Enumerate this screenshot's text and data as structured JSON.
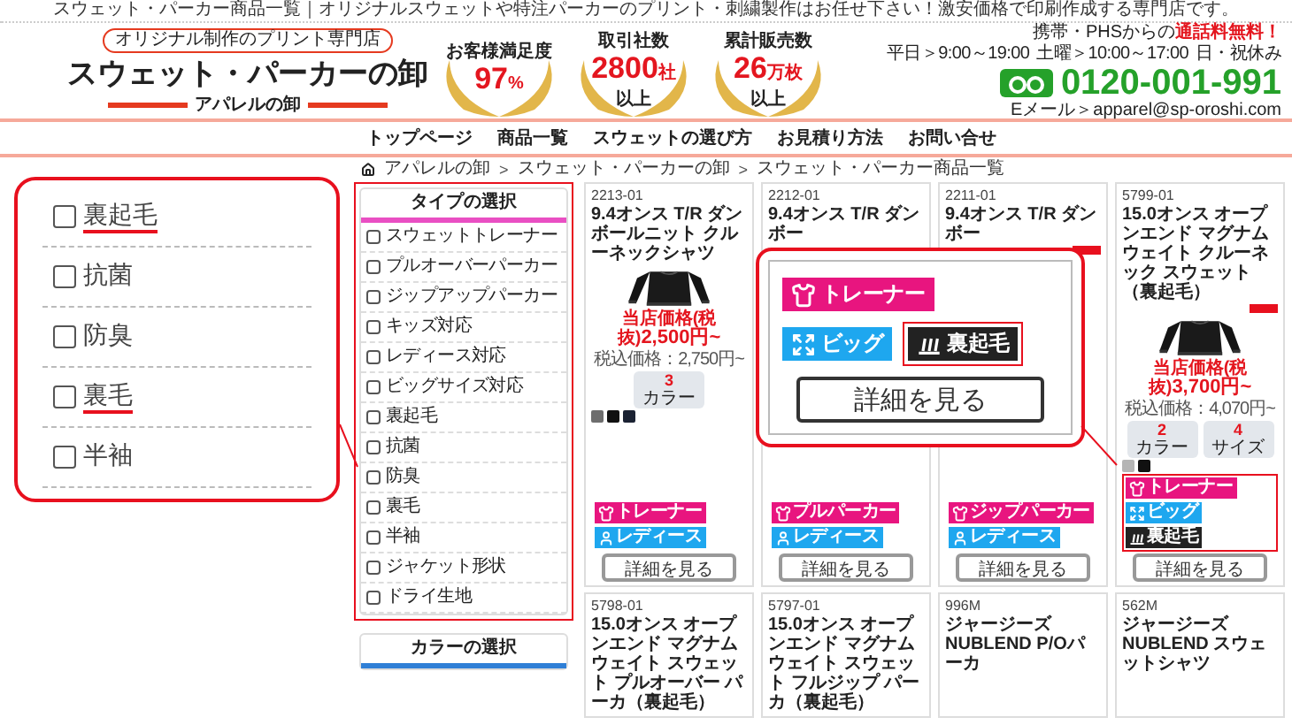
{
  "tagline": "スウェット・パーカー商品一覧｜オリジナルスウェットや特注パーカーのプリント・刺繍製作はお任せ下さい！激安価格で印刷作成する専門店です。",
  "header": {
    "badge": "オリジナル制作のプリント専門店",
    "title": "スウェット・パーカーの卸",
    "subtitle": "アパレルの卸",
    "medals": [
      {
        "label": "お客様満足度",
        "value": "97",
        "unit": "%"
      },
      {
        "label": "取引社数",
        "value": "2800",
        "unit": "社",
        "suffix": "以上"
      },
      {
        "label": "累計販売数",
        "value": "26",
        "unit": "万枚",
        "suffix": "以上"
      }
    ],
    "contact": {
      "note": "携帯・PHSからの",
      "note_free": "通話料無料！",
      "hours": [
        "平日＞9:00～19:00",
        "土曜＞10:00～17:00",
        "日・祝休み"
      ],
      "phone": "0120-001-991",
      "email": "Eメール＞apparel@sp-oroshi.com"
    }
  },
  "nav": [
    "トップページ",
    "商品一覧",
    "スウェットの選び方",
    "お見積り方法",
    "お問い合せ"
  ],
  "breadcrumb": {
    "separator": ">",
    "items": [
      "アパレルの卸",
      "スウェット・パーカーの卸",
      "スウェット・パーカー商品一覧"
    ]
  },
  "sidebar": [
    {
      "title": "タイプの選択",
      "color": "#e94fc3",
      "outlined": true,
      "items": [
        {
          "label": "スウェットトレーナー",
          "checked": false
        },
        {
          "label": "プルオーバーパーカー",
          "checked": false
        },
        {
          "label": "ジップアップパーカー",
          "checked": false
        },
        {
          "label": "キッズ対応",
          "checked": false
        },
        {
          "label": "レディース対応",
          "checked": false
        },
        {
          "label": "ビッグサイズ対応",
          "checked": false
        },
        {
          "label": "裏起毛",
          "checked": false
        },
        {
          "label": "抗菌",
          "checked": false
        },
        {
          "label": "防臭",
          "checked": false
        },
        {
          "label": "裏毛",
          "checked": false
        },
        {
          "label": "半袖",
          "checked": false
        },
        {
          "label": "ジャケット形状",
          "checked": false
        },
        {
          "label": "ドライ生地",
          "checked": false
        }
      ]
    },
    {
      "title": "カラーの選択",
      "color": "#2f7fd6",
      "outlined": false
    }
  ],
  "zoom_list": {
    "items": [
      {
        "label": "裏起毛",
        "checked": false,
        "highlighted": true
      },
      {
        "label": "抗菌",
        "checked": false,
        "highlighted": false
      },
      {
        "label": "防臭",
        "checked": false,
        "highlighted": false
      },
      {
        "label": "裏毛",
        "checked": false,
        "highlighted": true
      },
      {
        "label": "半袖",
        "checked": false,
        "highlighted": false
      }
    ]
  },
  "products": [
    {
      "code": "2213-01",
      "title": "9.4オンス T/R ダンボールニット クルーネックシャツ",
      "image": {
        "kind": "picture"
      },
      "price_label": "当店価格(税抜)",
      "price": "2,500円~",
      "tax_price": "税込価格：2,750円~",
      "counters": [
        {
          "value": "3",
          "label": "カラー"
        }
      ],
      "swatches": [
        {
          "color": "#6e6e6e"
        },
        {
          "color": "#111111"
        },
        {
          "color": "#1b2233"
        }
      ],
      "tags": [
        {
          "kind": "trainer",
          "label": "トレーナー",
          "color": "#e8157f"
        },
        {
          "kind": "ladies",
          "label": "レディース",
          "color": "#1ea7ef"
        }
      ],
      "button": "詳細を見る"
    },
    {
      "code": "2212-01",
      "title": "9.4オンス T/R ダンボー",
      "tags": [
        {
          "kind": "pullover",
          "label": "プルパーカー",
          "color": "#e8157f"
        },
        {
          "kind": "ladies",
          "label": "レディース",
          "color": "#1ea7ef"
        }
      ],
      "button": "詳細を見る"
    },
    {
      "code": "2211-01",
      "title": "9.4オンス T/R ダンボー",
      "corner_badge": true,
      "tags": [
        {
          "kind": "zip",
          "label": "ジップパーカー",
          "color": "#e8157f"
        },
        {
          "kind": "ladies",
          "label": "レディース",
          "color": "#1ea7ef"
        }
      ],
      "button": "詳細を見る"
    },
    {
      "code": "5799-01",
      "title": "15.0オンス オープンエンド マグナムウェイト クルーネック スウェット（裏起毛）",
      "corner_badge": true,
      "image": {
        "kind": "picture"
      },
      "price_label": "当店価格(税抜)",
      "price": "3,700円~",
      "tax_price": "税込価格：4,070円~",
      "counters": [
        {
          "value": "2",
          "label": "カラー"
        },
        {
          "value": "4",
          "label": "サイズ"
        }
      ],
      "swatches": [
        {
          "color": "#b5b5b5"
        },
        {
          "color": "#111111"
        }
      ],
      "tags_outlined": true,
      "tags": [
        {
          "kind": "trainer",
          "label": "トレーナー",
          "color": "#e8157f"
        },
        {
          "kind": "big",
          "label": "ビッグ",
          "color": "#1ea7ef"
        },
        {
          "kind": "brushed",
          "label": "裏起毛",
          "color": "#222222"
        }
      ],
      "button": "詳細を見る"
    },
    {
      "code": "5798-01",
      "title": "15.0オンス オープンエンド マグナムウェイト スウェット プルオーバー パーカ（裏起毛）"
    },
    {
      "code": "5797-01",
      "title": "15.0オンス オープンエンド マグナムウェイト スウェット フルジップ パーカ（裏起毛）"
    },
    {
      "code": "996M",
      "title": "ジャージーズNUBLEND P/Oパーカ"
    },
    {
      "code": "562M",
      "title": "ジャージーズNUBLEND スウェットシャツ"
    }
  ],
  "zoom_card": {
    "tags": [
      {
        "kind": "trainer",
        "label": "トレーナー",
        "color": "#e8157f",
        "highlighted": false
      },
      {
        "kind": "big",
        "label": "ビッグ",
        "color": "#1ea7ef",
        "highlighted": false
      },
      {
        "kind": "brushed",
        "label": "裏起毛",
        "color": "#222222",
        "highlighted": true
      }
    ],
    "button": "詳細を見る"
  }
}
